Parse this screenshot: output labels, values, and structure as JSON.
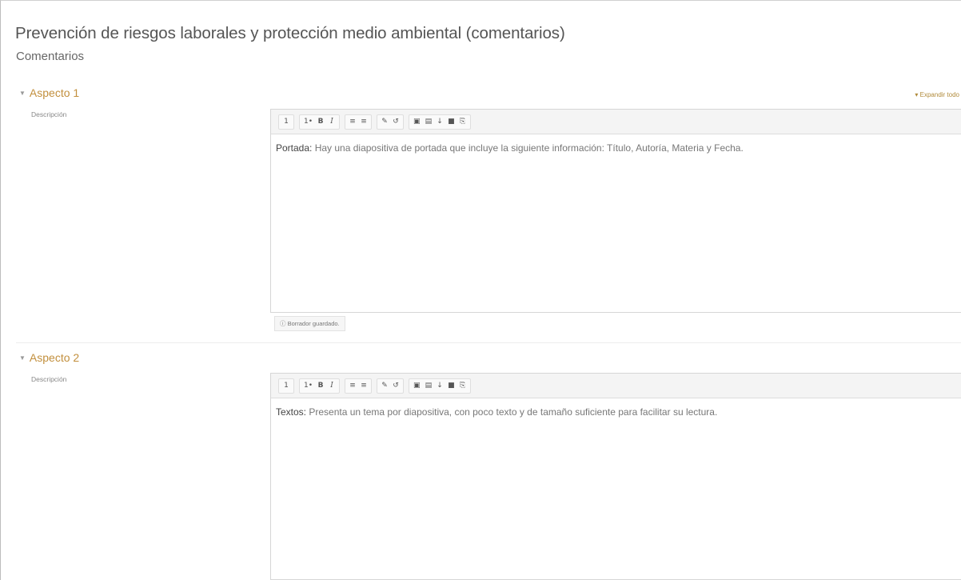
{
  "page": {
    "title": "Prevención de riesgos laborales y protección medio ambiental (comentarios)",
    "subtitle": "Comentarios",
    "expand_all": "▾ Expandir todo"
  },
  "toolbar": {
    "buttons": [
      "1",
      "1•",
      "B",
      "I",
      "≡",
      "≡",
      "✎",
      "↺",
      "▣",
      "▤",
      "↓",
      "■",
      "⎘"
    ]
  },
  "aspects": [
    {
      "heading": "Aspecto 1",
      "description_label": "Descripción",
      "lead": "Portada:",
      "text": " Hay una diapositiva de portada que incluye la siguiente información: Título, Autoría, Materia y Fecha.",
      "status": "ⓘ Borrador guardado."
    },
    {
      "heading": "Aspecto 2",
      "description_label": "Descripción",
      "lead": "Textos:",
      "text": " Presenta un tema por diapositiva, con poco texto y de tamaño suficiente para facilitar su lectura."
    }
  ]
}
